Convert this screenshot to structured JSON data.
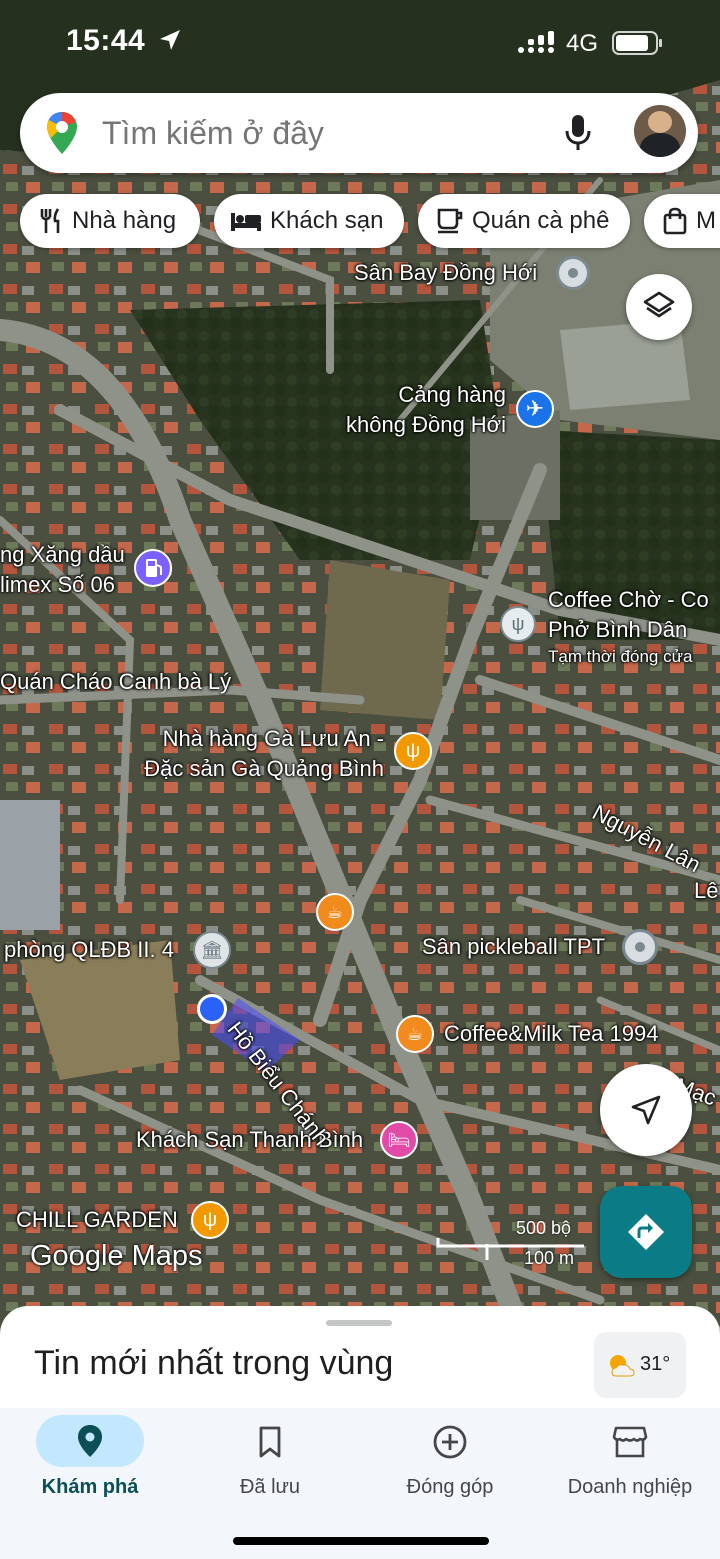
{
  "status_bar": {
    "time": "15:44",
    "network": "4G"
  },
  "search": {
    "placeholder": "Tìm kiếm ở đây"
  },
  "categories": [
    {
      "label": "Nhà hàng",
      "icon": "restaurant-icon"
    },
    {
      "label": "Khách sạn",
      "icon": "hotel-icon"
    },
    {
      "label": "Quán cà phê",
      "icon": "coffee-icon"
    },
    {
      "label": "M",
      "icon": "shopping-icon"
    }
  ],
  "map": {
    "places": [
      {
        "name": "Sân Bay Đồng Hới",
        "type": "landmark"
      },
      {
        "name": "Cảng hàng không Đồng Hới",
        "type": "airport"
      },
      {
        "name": "ng Xăng dầu limex Số 06",
        "type": "gas-station"
      },
      {
        "name": "Coffee Chờ - Co Phở Bình Dân",
        "type": "restaurant",
        "note": "Tạm thời đóng cửa"
      },
      {
        "name": "Quán Cháo Canh bà Lý",
        "type": "label"
      },
      {
        "name": "Nhà hàng Gà Lưu An - Đặc sản Gà Quảng Bình",
        "type": "restaurant"
      },
      {
        "name": "phòng QLĐB II. 4",
        "type": "government"
      },
      {
        "name": "Sân pickleball TPT",
        "type": "landmark"
      },
      {
        "name": "Coffee&Milk Tea 1994",
        "type": "cafe"
      },
      {
        "name": "Khách Sạn Thanh Bình",
        "type": "hotel"
      },
      {
        "name": "CHILL GARDEN",
        "type": "restaurant"
      }
    ],
    "streets": [
      "Hồ Biểu Chánh",
      "Nguyễn Lân",
      "Lê",
      "Mạc T"
    ],
    "labels": {
      "airport_landmark": "Sân Bay Đồng Hới",
      "airport_line1": "Cảng hàng",
      "airport_line2": "không Đồng Hới",
      "gas_line1": "ng Xăng dầu",
      "gas_line2": "limex Số 06",
      "coffee_line1": "Coffee Chờ - Co",
      "coffee_line2": "Phở Bình Dân",
      "coffee_note": "Tạm thời đóng cửa",
      "chao": "Quán Cháo Canh bà Lý",
      "ga_line1": "Nhà hàng Gà Lưu An -",
      "ga_line2": "Đặc sản Gà Quảng Bình",
      "qldb": "phòng QLĐB II. 4",
      "pickleball": "Sân pickleball TPT",
      "milktea": "Coffee&Milk Tea 1994",
      "hotel": "Khách Sạn Thanh Bình",
      "chill": "CHILL GARDEN",
      "street_hbc": "Hồ Biểu Chánh",
      "street_nl": "Nguyễn Lân",
      "street_le": "Lê",
      "street_mac": "Mạc T"
    },
    "scale": {
      "imperial": "500 bộ",
      "metric": "100 m"
    },
    "logo": "Google Maps"
  },
  "sheet": {
    "title": "Tin mới nhất trong vùng",
    "temperature": "31°"
  },
  "nav": [
    {
      "label": "Khám phá",
      "icon": "explore-pin-icon",
      "active": true
    },
    {
      "label": "Đã lưu",
      "icon": "bookmark-icon"
    },
    {
      "label": "Đóng góp",
      "icon": "add-circle-icon"
    },
    {
      "label": "Doanh nghiệp",
      "icon": "storefront-icon"
    }
  ],
  "colors": {
    "restaurant": "#f29900",
    "cafe": "#f28b1e",
    "hotel": "#e24aa8",
    "airport": "#1a73e8",
    "gas": "#7b61ff",
    "generic": "#8a9aa0",
    "directions": "#0b7c86",
    "active_nav": "#c2e7ff"
  }
}
